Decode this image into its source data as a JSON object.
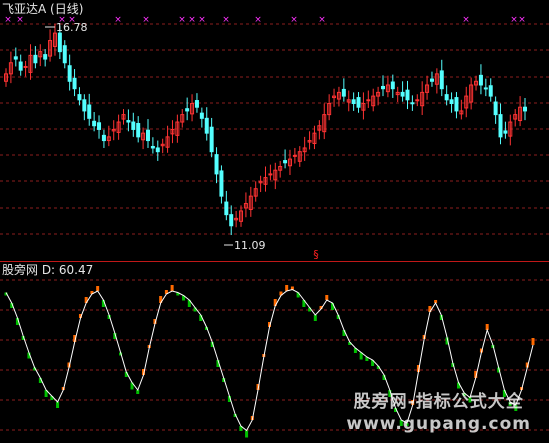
{
  "upper_title": "飞亚达A (日线)",
  "lower_title": "股旁网 D: 60.47",
  "high_label": "16.78",
  "low_label": "11.09",
  "section_marker": "§",
  "watermark_line1": "股旁网-指标公式大全",
  "watermark_line2": "www.gupang.com",
  "colors": {
    "background": "#000000",
    "up": "#ff3333",
    "down": "#54ffff",
    "grid": "#8b1e1e",
    "signal": "#ff33ff",
    "green": "#00c000",
    "orange": "#ff6a00",
    "white": "#ffffff"
  },
  "chart_data": [
    {
      "type": "candlestick",
      "title": "飞亚达A (日线)",
      "annotations": [
        {
          "text": "16.78",
          "meaning": "high"
        },
        {
          "text": "11.09",
          "meaning": "low"
        }
      ],
      "close": [
        15.6,
        15.9,
        16.0,
        15.7,
        15.8,
        16.1,
        15.9,
        16.2,
        16.0,
        16.5,
        16.7,
        16.2,
        15.9,
        15.4,
        15.2,
        14.9,
        14.6,
        14.4,
        14.2,
        14.1,
        13.8,
        13.9,
        14.1,
        14.3,
        14.5,
        14.3,
        14.1,
        13.9,
        14.0,
        13.8,
        13.6,
        13.5,
        13.7,
        13.9,
        14.1,
        14.3,
        14.5,
        14.6,
        14.8,
        14.7,
        14.4,
        14.0,
        13.5,
        12.9,
        12.3,
        11.8,
        11.5,
        11.7,
        11.9,
        12.1,
        12.3,
        12.5,
        12.7,
        12.8,
        12.9,
        13.0,
        13.1,
        13.2,
        13.3,
        13.4,
        13.5,
        13.6,
        13.8,
        14.0,
        14.2,
        14.5,
        14.8,
        15.0,
        15.1,
        15.0,
        14.9,
        14.8,
        14.7,
        14.8,
        14.9,
        15.0,
        15.1,
        15.2,
        15.3,
        15.2,
        15.1,
        15.0,
        14.9,
        14.8,
        14.9,
        15.1,
        15.3,
        15.4,
        15.6,
        15.2,
        14.9,
        14.8,
        14.6,
        14.6,
        15.0,
        15.3,
        15.4,
        15.3,
        15.2,
        15.0,
        14.5,
        13.9,
        14.0,
        14.3,
        14.5,
        14.7,
        14.6
      ]
    },
    {
      "type": "line",
      "title": "股旁网 D: 60.47",
      "series": [
        {
          "name": "D",
          "values": [
            95,
            88,
            78,
            66,
            55,
            45,
            38,
            30,
            26,
            22,
            30,
            45,
            62,
            78,
            88,
            94,
            96,
            90,
            80,
            68,
            55,
            42,
            35,
            30,
            40,
            58,
            74,
            88,
            94,
            96,
            95,
            93,
            90,
            85,
            80,
            72,
            62,
            50,
            38,
            26,
            14,
            6,
            3,
            10,
            30,
            52,
            72,
            86,
            93,
            96,
            97,
            95,
            90,
            85,
            80,
            84,
            90,
            88,
            80,
            70,
            62,
            58,
            55,
            52,
            50,
            46,
            40,
            30,
            18,
            10,
            8,
            20,
            42,
            64,
            82,
            88,
            80,
            65,
            48,
            35,
            28,
            25,
            38,
            55,
            70,
            60,
            45,
            30,
            22,
            20,
            30,
            45,
            60
          ]
        }
      ]
    }
  ]
}
